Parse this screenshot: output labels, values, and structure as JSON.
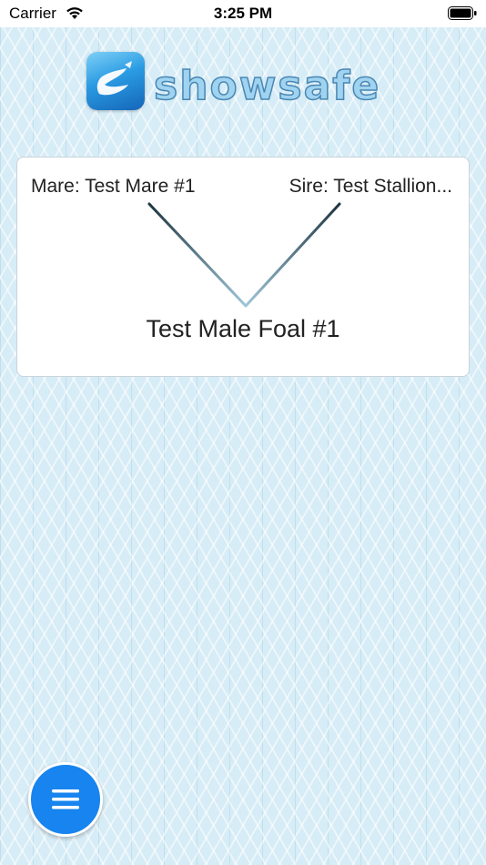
{
  "status_bar": {
    "carrier": "Carrier",
    "time": "3:25 PM"
  },
  "logo": {
    "text": "showsafe",
    "icon": "showsafe-logo-icon"
  },
  "pedigree": {
    "mare_label": "Mare: Test Mare #1",
    "sire_label": "Sire: Test Stallion...",
    "foal_name": "Test Male Foal #1"
  },
  "menu_button": {
    "icon": "hamburger-menu-icon",
    "color": "#1784ef"
  },
  "colors": {
    "background": "#d6ecf6",
    "card": "#ffffff",
    "accent": "#1784ef"
  }
}
